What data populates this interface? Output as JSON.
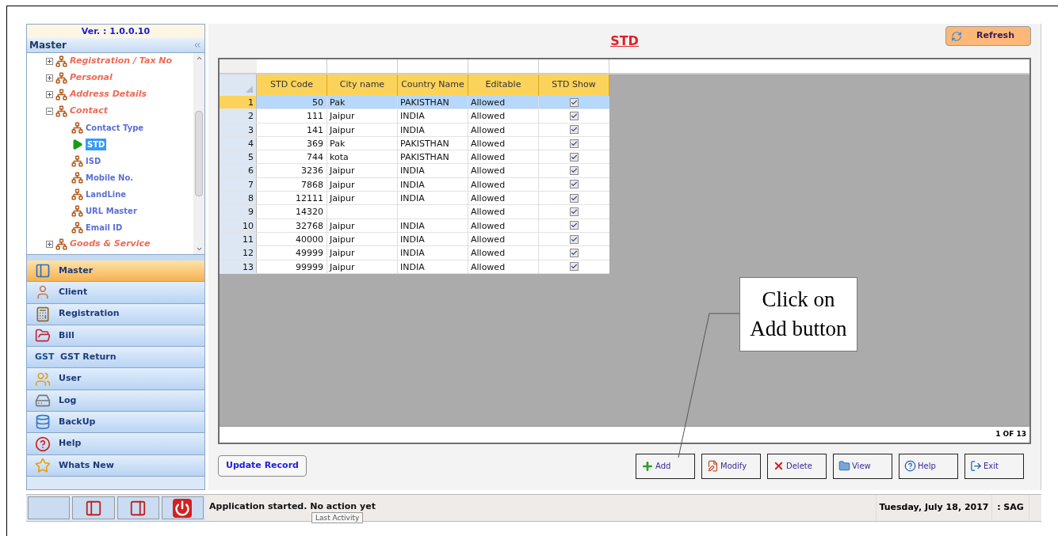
{
  "sidebar": {
    "version": "Ver. : 1.0.0.10",
    "panel_title": "Master",
    "tree": [
      {
        "label": "Registration / Tax No",
        "expanded": false
      },
      {
        "label": "Personal",
        "expanded": false
      },
      {
        "label": "Address Details",
        "expanded": false
      },
      {
        "label": "Contact",
        "expanded": true,
        "children": [
          {
            "label": "Contact Type",
            "selected": false
          },
          {
            "label": "STD",
            "selected": true
          },
          {
            "label": "ISD",
            "selected": false
          },
          {
            "label": "Mobile No.",
            "selected": false
          },
          {
            "label": "LandLine",
            "selected": false
          },
          {
            "label": "URL Master",
            "selected": false
          },
          {
            "label": "Email ID",
            "selected": false
          }
        ]
      },
      {
        "label": "Goods & Service",
        "expanded": false
      }
    ],
    "nav": [
      {
        "label": "Master",
        "selected": true
      },
      {
        "label": "Client",
        "selected": false
      },
      {
        "label": "Registration",
        "selected": false
      },
      {
        "label": "Bill",
        "selected": false
      },
      {
        "label": "GST Return",
        "selected": false,
        "icon_text": "GST"
      },
      {
        "label": "User",
        "selected": false
      },
      {
        "label": "Log",
        "selected": false
      },
      {
        "label": "BackUp",
        "selected": false
      },
      {
        "label": "Help",
        "selected": false
      },
      {
        "label": "Whats New",
        "selected": false
      }
    ]
  },
  "page_title": "STD",
  "refresh_button": "Refresh",
  "grid": {
    "columns": [
      "STD Code",
      "City name",
      "Country Name",
      "Editable",
      "STD Show"
    ],
    "rows": [
      {
        "number": "1",
        "std_code": "50",
        "city": "Pak",
        "country": "PAKISTHAN",
        "editable": "Allowed",
        "std_show": true,
        "selected": true
      },
      {
        "number": "2",
        "std_code": "111",
        "city": "Jaipur",
        "country": "INDIA",
        "editable": "Allowed",
        "std_show": true,
        "selected": false
      },
      {
        "number": "3",
        "std_code": "141",
        "city": "Jaipur",
        "country": "INDIA",
        "editable": "Allowed",
        "std_show": true,
        "selected": false
      },
      {
        "number": "4",
        "std_code": "369",
        "city": "Pak",
        "country": "PAKISTHAN",
        "editable": "Allowed",
        "std_show": true,
        "selected": false
      },
      {
        "number": "5",
        "std_code": "744",
        "city": "kota",
        "country": "PAKISTHAN",
        "editable": "Allowed",
        "std_show": true,
        "selected": false
      },
      {
        "number": "6",
        "std_code": "3236",
        "city": "Jaipur",
        "country": "INDIA",
        "editable": "Allowed",
        "std_show": true,
        "selected": false
      },
      {
        "number": "7",
        "std_code": "7868",
        "city": "Jaipur",
        "country": "INDIA",
        "editable": "Allowed",
        "std_show": true,
        "selected": false
      },
      {
        "number": "8",
        "std_code": "12111",
        "city": "Jaipur",
        "country": "INDIA",
        "editable": "Allowed",
        "std_show": true,
        "selected": false
      },
      {
        "number": "9",
        "std_code": "14320",
        "editable": "Allowed",
        "std_show": true,
        "selected": false
      },
      {
        "number": "10",
        "std_code": "32768",
        "city": "Jaipur",
        "country": "INDIA",
        "editable": "Allowed",
        "std_show": true,
        "selected": false
      },
      {
        "number": "11",
        "std_code": "40000",
        "city": "Jaipur",
        "country": "INDIA",
        "editable": "Allowed",
        "std_show": true,
        "selected": false
      },
      {
        "number": "12",
        "std_code": "49999",
        "city": "Jaipur",
        "country": "INDIA",
        "editable": "Allowed",
        "std_show": true,
        "selected": false
      },
      {
        "number": "13",
        "std_code": "99999",
        "city": "Jaipur",
        "country": "INDIA",
        "editable": "Allowed",
        "std_show": true,
        "selected": false
      }
    ],
    "page_indicator": "1 OF 13"
  },
  "update_button": "Update Record",
  "action_buttons": [
    {
      "label": "Add",
      "kind": "add"
    },
    {
      "label": "Modify",
      "kind": "modify"
    },
    {
      "label": "Delete",
      "kind": "delete"
    },
    {
      "label": "View",
      "kind": "view"
    },
    {
      "label": "Help",
      "kind": "help"
    },
    {
      "label": "Exit",
      "kind": "exit"
    }
  ],
  "status_bar": {
    "message": "Application started. No action yet",
    "tooltip": "Last Activity",
    "date": "Tuesday, July 18, 2017",
    "user": ": SAG"
  },
  "callout": {
    "text": "Click on Add button"
  }
}
